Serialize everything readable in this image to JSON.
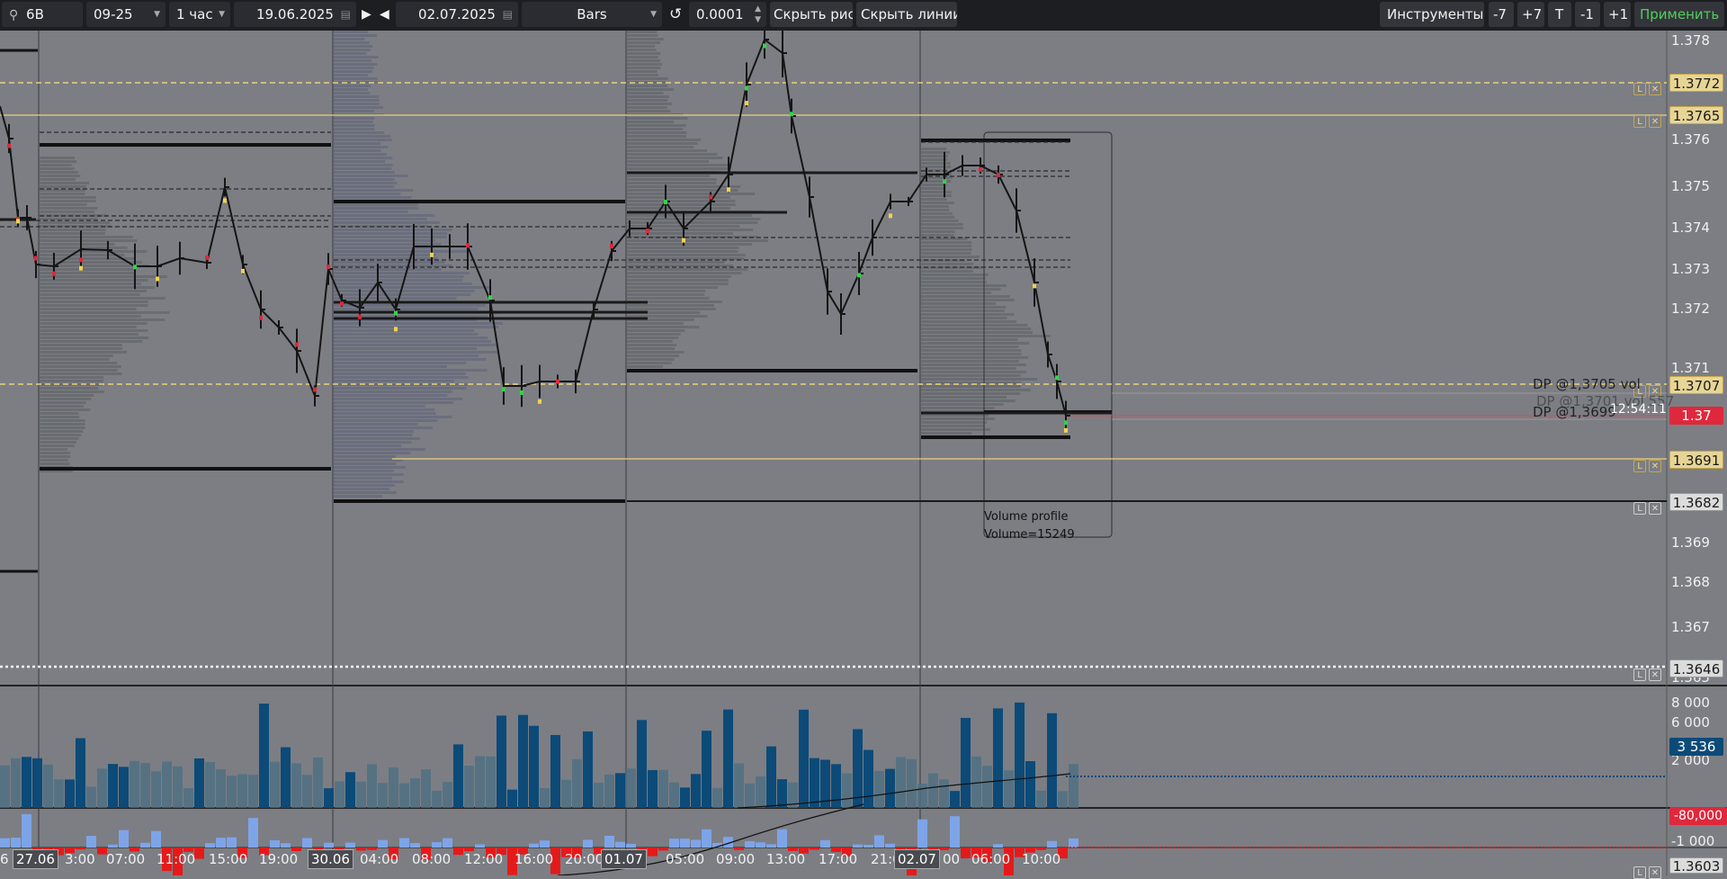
{
  "toolbar": {
    "symbol": "6B",
    "contract": "09-25",
    "timeframe": "1 час",
    "date_from": "19.06.2025",
    "date_to": "02.07.2025",
    "chart_type": "Bars",
    "tick_size": "0.0001",
    "hide_drawings": "Скрыть рис.",
    "hide_lines": "Скрыть линии",
    "tools": "Инструменты",
    "m7": "-7",
    "p7": "+7",
    "t": "T",
    "m1": "-1",
    "p1": "+1",
    "apply": "Применить"
  },
  "icons": {
    "search": "search-icon",
    "play": "play-icon",
    "back": "step-back-icon",
    "refresh": "refresh-icon",
    "calendar": "calendar-icon",
    "lock": "lock-icon",
    "close": "close-icon"
  },
  "price_axis": {
    "ticks": [
      "1.378",
      "1.376",
      "1.375",
      "1.374",
      "1.373",
      "1.372",
      "1.371",
      "1.369",
      "1.368",
      "1.367",
      "1.366",
      "1.365"
    ],
    "labels": {
      "l1": "1.3772",
      "l2": "1.3765",
      "l3": "1.3707",
      "l4": "1.37",
      "l5": "1.3691",
      "l6": "1.3682",
      "l7": "1.3646",
      "l8": "1.3603"
    },
    "volume_ticks": [
      "8 000",
      "6 000",
      "2 000"
    ],
    "volume_value": "3 536",
    "delta_ticks": [
      "-1 000"
    ],
    "delta_value": "-80,000"
  },
  "time_axis": {
    "ticks": [
      "3:00",
      "07:00",
      "11:00",
      "15:00",
      "19:00",
      "04:00",
      "08:00",
      "12:00",
      "16:00",
      "20:00",
      "05:00",
      "09:00",
      "13:00",
      "17:00",
      "21:00",
      "00",
      "06:00",
      "10:00"
    ],
    "dates": [
      "27.06",
      "30.06",
      "01.07",
      "02.07"
    ],
    "first_partial": "6"
  },
  "annotations": {
    "dp1": "DP @1,3705 vol",
    "dp2": "DP @1,3701 vol 557",
    "dp3": "DP @1,3699",
    "clock": "12:54:11",
    "vp_title": "Volume profile",
    "vp_volume": "Volume=15249"
  },
  "colors": {
    "background": "#7c7e84",
    "bull": "#2fd64a",
    "bear": "#e0283c",
    "level_yellow": "#e7d596",
    "volume_bar": "#0c4a78",
    "delta_pos": "#7ea4e8",
    "delta_neg": "#e41a1a"
  }
}
